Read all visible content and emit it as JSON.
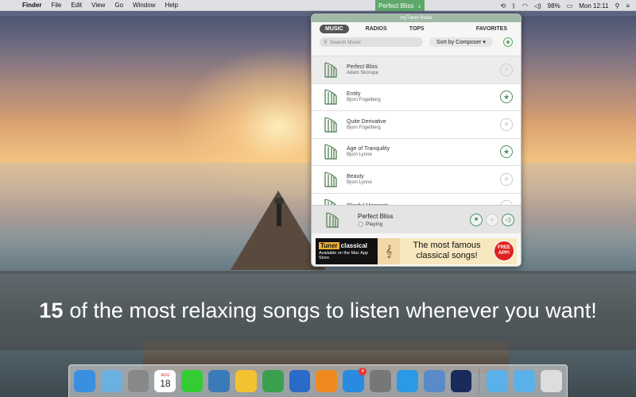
{
  "menubar": {
    "apple": "",
    "items": [
      "Finder",
      "File",
      "Edit",
      "View",
      "Go",
      "Window",
      "Help"
    ],
    "now_playing": "Perfect Bliss",
    "battery": "98%",
    "clock": "Mon 12:11"
  },
  "widget": {
    "title": "myTuner Relax",
    "tabs": [
      "MUSIC",
      "RADIOS",
      "TOPS",
      "FAVORITES"
    ],
    "search_placeholder": "Search Music",
    "sort_label": "Sort by Composer",
    "songs": [
      {
        "title": "Perfect Bliss",
        "artist": "Adam Skorupa",
        "favorite": false,
        "active": true
      },
      {
        "title": "Entity",
        "artist": "Bjorn Fogelberg",
        "favorite": true,
        "active": false
      },
      {
        "title": "Quite Derivative",
        "artist": "Bjorn Fogelberg",
        "favorite": false,
        "active": false
      },
      {
        "title": "Age of Tranquility",
        "artist": "Bjorn Lynne",
        "favorite": true,
        "active": false
      },
      {
        "title": "Beauty",
        "artist": "Bjorn Lynne",
        "favorite": false,
        "active": false
      },
      {
        "title": "Blissful Moments",
        "artist": "",
        "favorite": false,
        "active": false
      }
    ],
    "player": {
      "title": "Perfect Bliss",
      "status": "Playing"
    },
    "ad": {
      "brand_a": "Tuner",
      "brand_b": "classical",
      "store": "Available on the Mac App Store",
      "text": "The most famous classical songs!",
      "badge": "FREE APP!"
    }
  },
  "caption": {
    "number": "15",
    "text": "of the most relaxing songs to listen whenever you want!"
  },
  "dock": {
    "calendar_day": "18",
    "calendar_month": "AUG",
    "appstore_badge": "4",
    "apps": [
      {
        "name": "finder-icon",
        "color": "#3a8fe0"
      },
      {
        "name": "preview-icon",
        "color": "#6ab0e0"
      },
      {
        "name": "launchpad-icon",
        "color": "#888"
      },
      {
        "name": "calendar-icon",
        "color": "#fff"
      },
      {
        "name": "facetime-icon",
        "color": "#3c3"
      },
      {
        "name": "photos-icon",
        "color": "#3a7ab8"
      },
      {
        "name": "notes-icon",
        "color": "#f3c230"
      },
      {
        "name": "numbers-icon",
        "color": "#3aa050"
      },
      {
        "name": "itunes-icon",
        "color": "#2a6ac8"
      },
      {
        "name": "ibooks-icon",
        "color": "#f08a20"
      },
      {
        "name": "appstore-icon",
        "color": "#2a8ae0"
      },
      {
        "name": "system-preferences-icon",
        "color": "#777"
      },
      {
        "name": "safari-icon",
        "color": "#2a9ae8"
      },
      {
        "name": "preview-app-icon",
        "color": "#5a8ac8"
      },
      {
        "name": "photoshop-icon",
        "color": "#1a2a5a"
      },
      {
        "name": "downloads-folder-icon",
        "color": "#5ab0e8"
      },
      {
        "name": "applications-folder-icon",
        "color": "#5ab0e8"
      },
      {
        "name": "trash-icon",
        "color": "#ddd"
      }
    ]
  }
}
